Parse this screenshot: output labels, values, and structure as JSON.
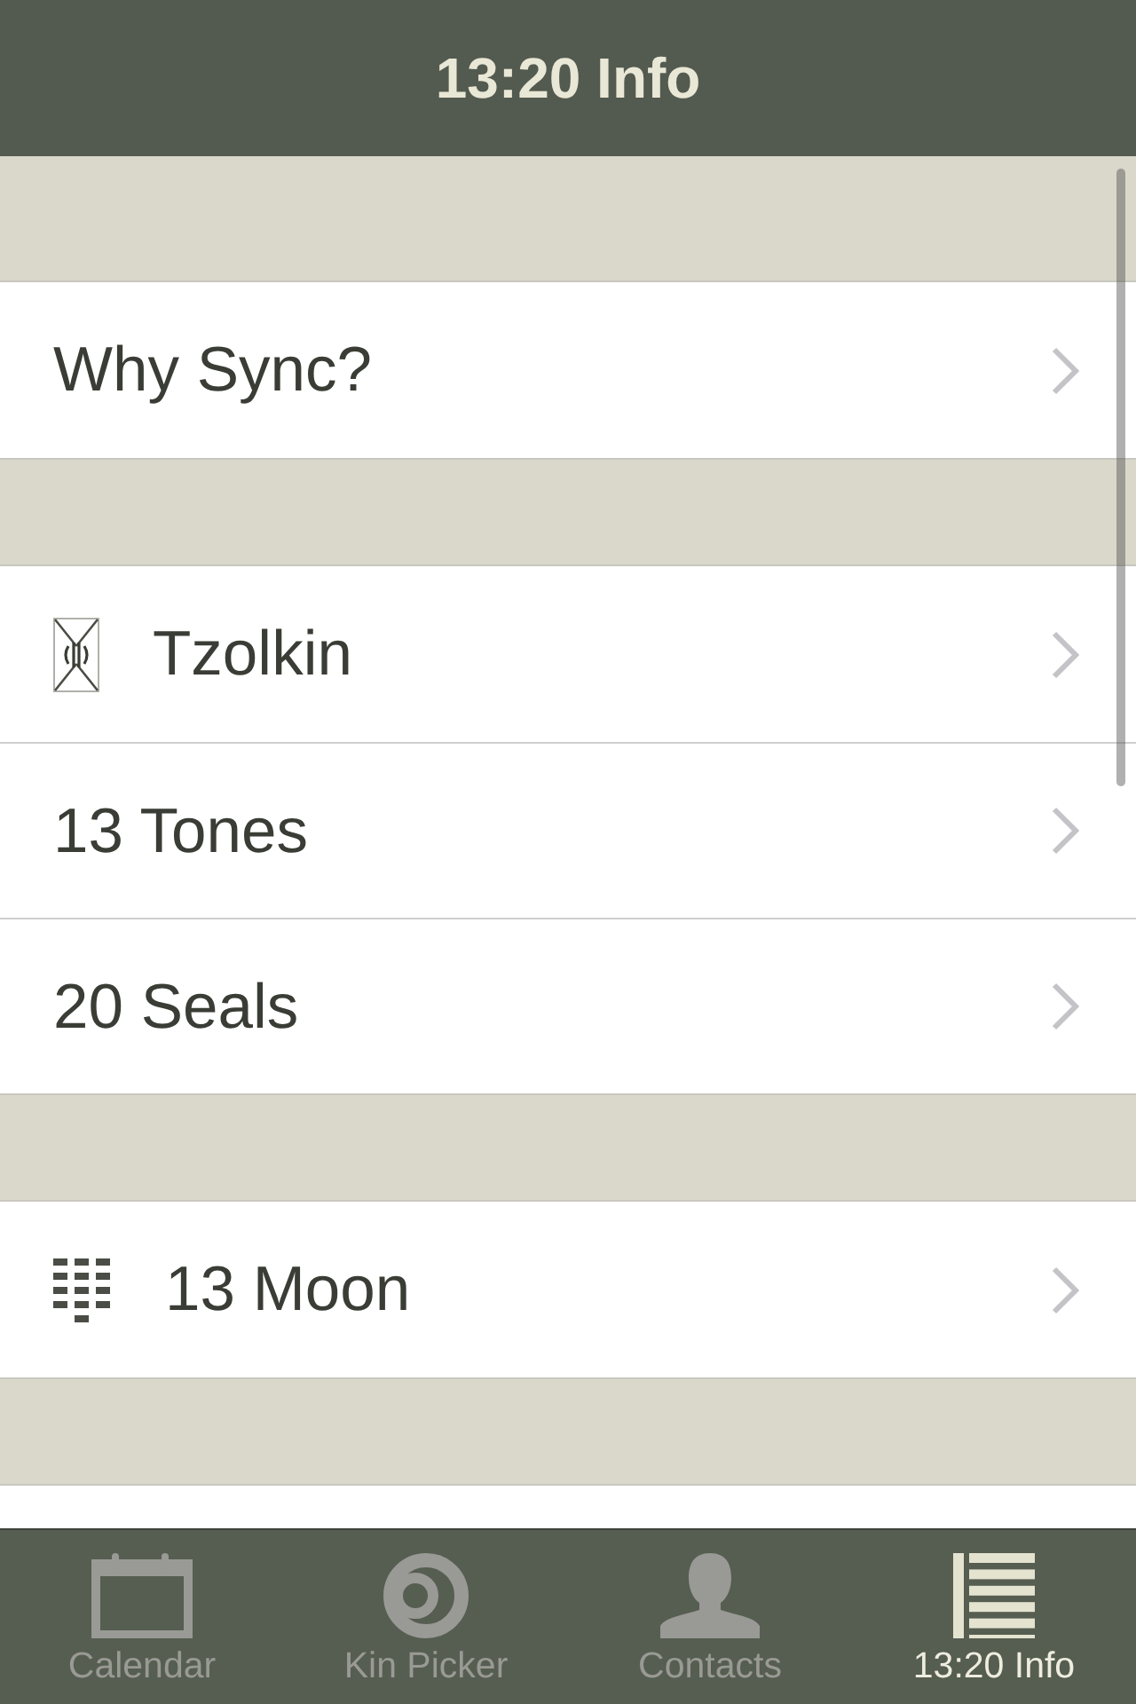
{
  "nav_bar": {
    "title": "13:20 Info"
  },
  "sections": [
    {
      "rows": [
        {
          "kind": "plain",
          "label": "Why Sync?"
        }
      ]
    },
    {
      "rows": [
        {
          "kind": "tzolkin",
          "label": "Tzolkin"
        },
        {
          "kind": "plain",
          "label": "13 Tones"
        },
        {
          "kind": "plain",
          "label": "20 Seals"
        }
      ]
    },
    {
      "rows": [
        {
          "kind": "moon",
          "label": "13 Moon"
        }
      ]
    },
    {
      "rows": [
        {
          "kind": "blank"
        }
      ]
    }
  ],
  "tab_bar": {
    "tabs": [
      {
        "kind": "calendar",
        "label": "Calendar",
        "selected": false
      },
      {
        "kind": "ring",
        "label": "Kin Picker",
        "selected": false
      },
      {
        "kind": "person",
        "label": "Contacts",
        "selected": false
      },
      {
        "kind": "list",
        "label": "13:20 Info",
        "selected": true
      }
    ]
  }
}
